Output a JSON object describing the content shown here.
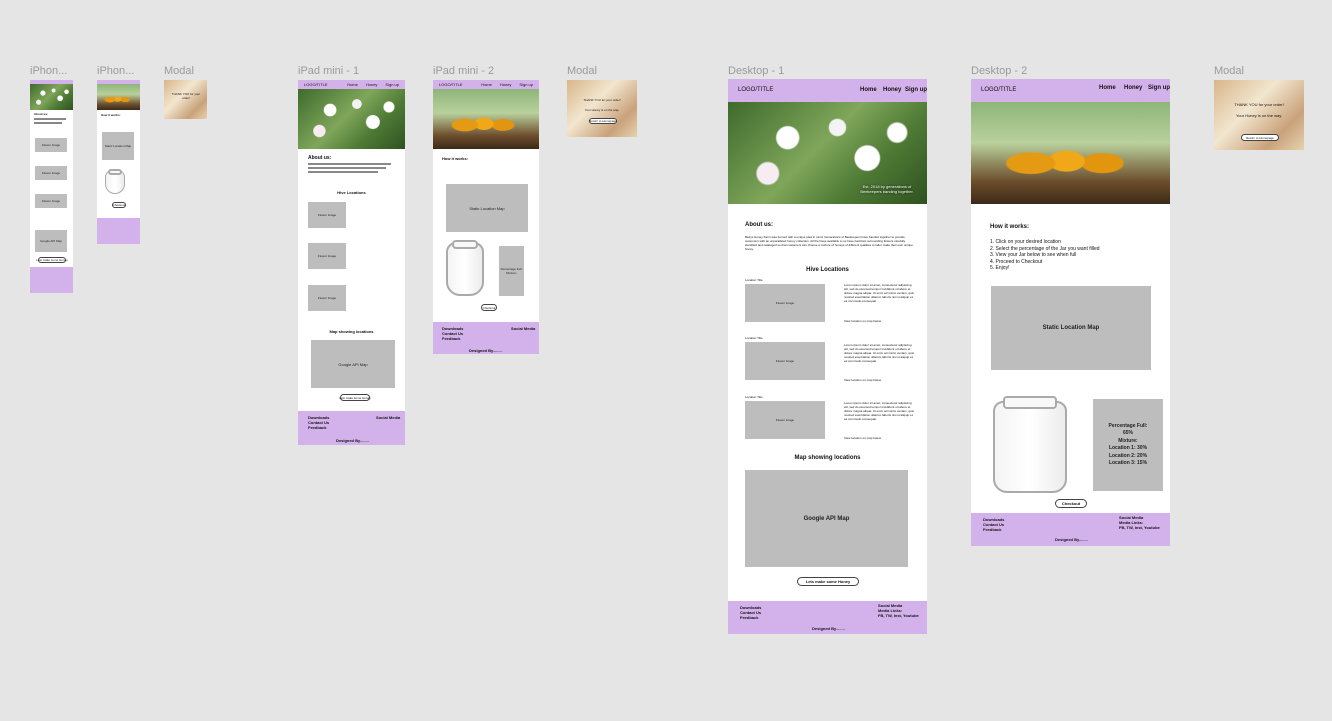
{
  "frames": {
    "iphone1": "iPhon...",
    "iphone2": "iPhon...",
    "modal_small": "Modal",
    "ipad1": "iPad mini - 1",
    "ipad2": "iPad mini - 2",
    "modal_mid": "Modal",
    "desktop1": "Desktop - 1",
    "desktop2": "Desktop - 2",
    "modal_large": "Modal"
  },
  "header": {
    "logo": "LOGO/TITLE",
    "nav": [
      "Home",
      "Honey",
      "Sign up"
    ]
  },
  "hero_caption": "Est. 2018 by generations of Beekeepers banding together.",
  "about": {
    "title": "About us:",
    "text": "Bettys Honey Farm was formed with a unique idea in mind. Generations of Beekeepers have banded together to provide customers with an unparalleled honey collection. All the hives available to us have had their surrounding flowers carefully identified and cataloged so that customers can choose a mixture of honeys of different qualities to tailor make their own unique honey."
  },
  "hive": {
    "title": "Hive Locations",
    "location_title": "Location Title",
    "flower_image": "Flower Image",
    "body": "Lorem ipsum dolor sit amet, consectetur adipiscing elit, sed do eiusmod tempor incididunt ut labore et dolore magna aliqua. Ut enim ad minim veniam, quis nostrud exercitation ullamco laboris nisi ut aliquip ex ea commodo consequat.",
    "view_link": "View location on map below"
  },
  "map": {
    "title": "Map showing locations",
    "google": "Google API Map",
    "cta": "Lets make some Honey"
  },
  "how": {
    "title": "How it works:",
    "steps": [
      "1. Click on your desired location",
      "2. Select the percentage of the Jar you want filled",
      "3. View your Jar below to see when full",
      "4. Proceed to Checkout",
      "5. Enjoy!"
    ],
    "static_map": "Static Location Map",
    "percentage_label": "Percentage Full:",
    "percentage_value": "65%",
    "mixture": "Mixture:",
    "loc1": "Location 1: 30%",
    "loc2": "Location 2: 20%",
    "loc3": "Location 3: 15%",
    "checkout": "Checkout"
  },
  "footer": {
    "downloads": "Downloads",
    "contact": "Contact Us",
    "feedback": "Feedback",
    "social": "Social Media",
    "media_links": "Media Links:",
    "links": "FB, TW, Inst, Youtube",
    "designed": "Designed By........"
  },
  "modal": {
    "thanks": "THANK YOU for your order!",
    "onway": "Your Honey is on the way.",
    "button": "Return to Homepage"
  }
}
